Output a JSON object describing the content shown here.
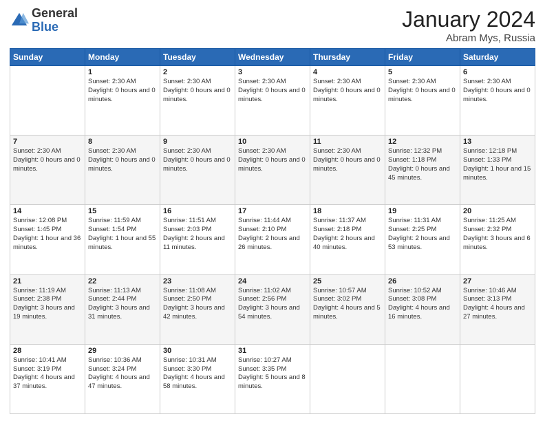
{
  "header": {
    "logo": {
      "general": "General",
      "blue": "Blue"
    },
    "month": "January 2024",
    "location": "Abram Mys, Russia"
  },
  "weekdays": [
    "Sunday",
    "Monday",
    "Tuesday",
    "Wednesday",
    "Thursday",
    "Friday",
    "Saturday"
  ],
  "weeks": [
    [
      {
        "day": "",
        "info": ""
      },
      {
        "day": "1",
        "info": "Sunset: 2:30 AM\nDaylight: 0 hours and 0 minutes."
      },
      {
        "day": "2",
        "info": "Sunset: 2:30 AM\nDaylight: 0 hours and 0 minutes."
      },
      {
        "day": "3",
        "info": "Sunset: 2:30 AM\nDaylight: 0 hours and 0 minutes."
      },
      {
        "day": "4",
        "info": "Sunset: 2:30 AM\nDaylight: 0 hours and 0 minutes."
      },
      {
        "day": "5",
        "info": "Sunset: 2:30 AM\nDaylight: 0 hours and 0 minutes."
      },
      {
        "day": "6",
        "info": "Sunset: 2:30 AM\nDaylight: 0 hours and 0 minutes."
      }
    ],
    [
      {
        "day": "7",
        "info": "Sunset: 2:30 AM\nDaylight: 0 hours and 0 minutes."
      },
      {
        "day": "8",
        "info": "Sunset: 2:30 AM\nDaylight: 0 hours and 0 minutes."
      },
      {
        "day": "9",
        "info": "Sunset: 2:30 AM\nDaylight: 0 hours and 0 minutes."
      },
      {
        "day": "10",
        "info": "Sunset: 2:30 AM\nDaylight: 0 hours and 0 minutes."
      },
      {
        "day": "11",
        "info": "Sunset: 2:30 AM\nDaylight: 0 hours and 0 minutes."
      },
      {
        "day": "12",
        "info": "Sunrise: 12:32 PM\nSunset: 1:18 PM\nDaylight: 0 hours and 45 minutes."
      },
      {
        "day": "13",
        "info": "Sunrise: 12:18 PM\nSunset: 1:33 PM\nDaylight: 1 hour and 15 minutes."
      }
    ],
    [
      {
        "day": "14",
        "info": "Sunrise: 12:08 PM\nSunset: 1:45 PM\nDaylight: 1 hour and 36 minutes."
      },
      {
        "day": "15",
        "info": "Sunrise: 11:59 AM\nSunset: 1:54 PM\nDaylight: 1 hour and 55 minutes."
      },
      {
        "day": "16",
        "info": "Sunrise: 11:51 AM\nSunset: 2:03 PM\nDaylight: 2 hours and 11 minutes."
      },
      {
        "day": "17",
        "info": "Sunrise: 11:44 AM\nSunset: 2:10 PM\nDaylight: 2 hours and 26 minutes."
      },
      {
        "day": "18",
        "info": "Sunrise: 11:37 AM\nSunset: 2:18 PM\nDaylight: 2 hours and 40 minutes."
      },
      {
        "day": "19",
        "info": "Sunrise: 11:31 AM\nSunset: 2:25 PM\nDaylight: 2 hours and 53 minutes."
      },
      {
        "day": "20",
        "info": "Sunrise: 11:25 AM\nSunset: 2:32 PM\nDaylight: 3 hours and 6 minutes."
      }
    ],
    [
      {
        "day": "21",
        "info": "Sunrise: 11:19 AM\nSunset: 2:38 PM\nDaylight: 3 hours and 19 minutes."
      },
      {
        "day": "22",
        "info": "Sunrise: 11:13 AM\nSunset: 2:44 PM\nDaylight: 3 hours and 31 minutes."
      },
      {
        "day": "23",
        "info": "Sunrise: 11:08 AM\nSunset: 2:50 PM\nDaylight: 3 hours and 42 minutes."
      },
      {
        "day": "24",
        "info": "Sunrise: 11:02 AM\nSunset: 2:56 PM\nDaylight: 3 hours and 54 minutes."
      },
      {
        "day": "25",
        "info": "Sunrise: 10:57 AM\nSunset: 3:02 PM\nDaylight: 4 hours and 5 minutes."
      },
      {
        "day": "26",
        "info": "Sunrise: 10:52 AM\nSunset: 3:08 PM\nDaylight: 4 hours and 16 minutes."
      },
      {
        "day": "27",
        "info": "Sunrise: 10:46 AM\nSunset: 3:13 PM\nDaylight: 4 hours and 27 minutes."
      }
    ],
    [
      {
        "day": "28",
        "info": "Sunrise: 10:41 AM\nSunset: 3:19 PM\nDaylight: 4 hours and 37 minutes."
      },
      {
        "day": "29",
        "info": "Sunrise: 10:36 AM\nSunset: 3:24 PM\nDaylight: 4 hours and 47 minutes."
      },
      {
        "day": "30",
        "info": "Sunrise: 10:31 AM\nSunset: 3:30 PM\nDaylight: 4 hours and 58 minutes."
      },
      {
        "day": "31",
        "info": "Sunrise: 10:27 AM\nSunset: 3:35 PM\nDaylight: 5 hours and 8 minutes."
      },
      {
        "day": "",
        "info": ""
      },
      {
        "day": "",
        "info": ""
      },
      {
        "day": "",
        "info": ""
      }
    ]
  ]
}
